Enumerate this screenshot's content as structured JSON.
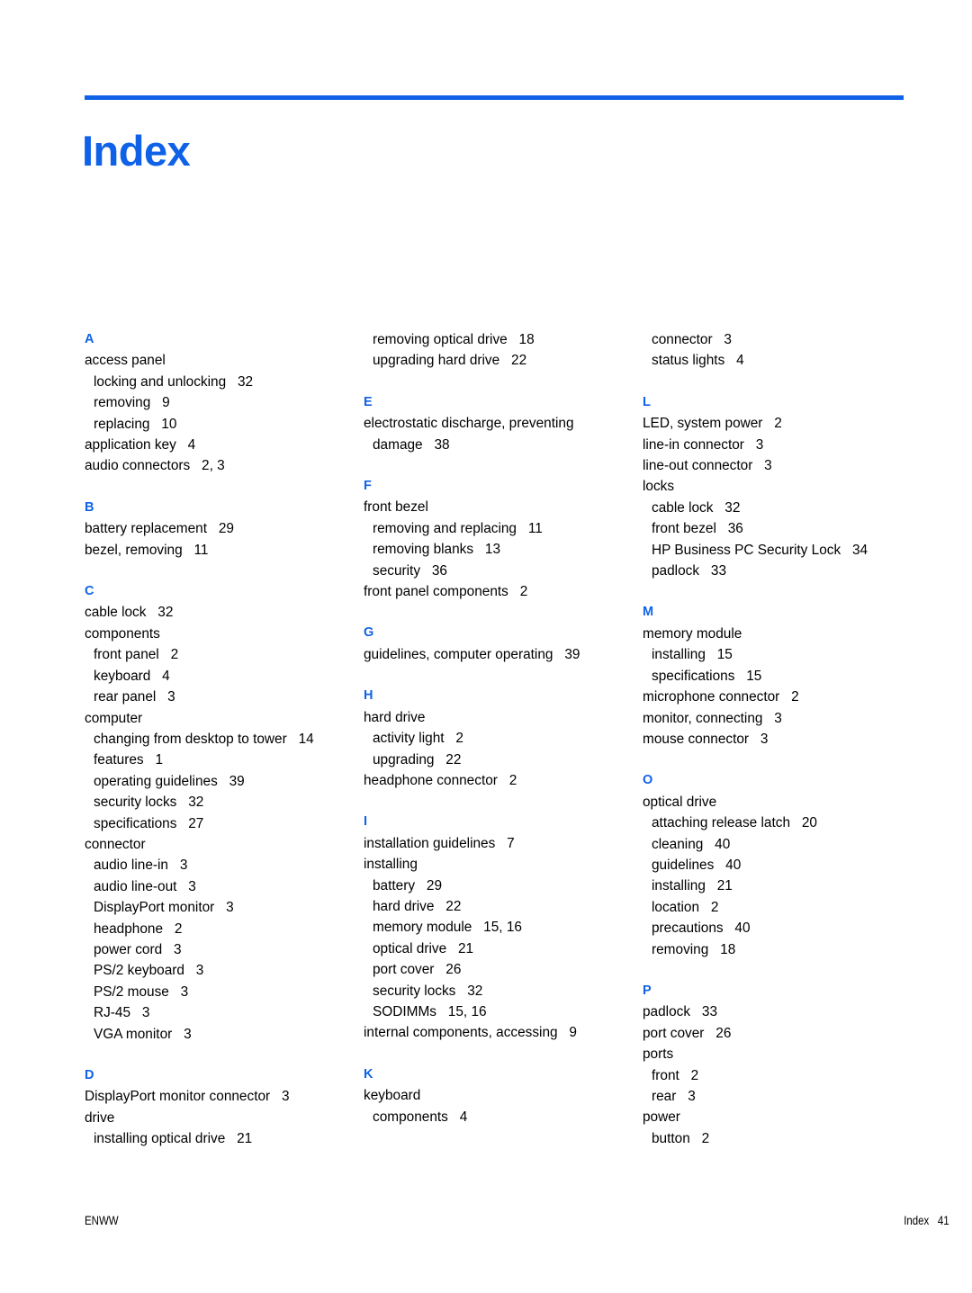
{
  "document": {
    "title": "Index",
    "accent_color": "#0f62e8",
    "text_color": "#000000",
    "background_color": "#ffffff"
  },
  "footer": {
    "left": "ENWW",
    "right": "Index   41"
  },
  "columns": [
    {
      "id": "column-1",
      "blocks": [
        {
          "type": "letter",
          "text": "A",
          "first": true
        },
        {
          "type": "entry",
          "level": 1,
          "text": "access panel",
          "page": ""
        },
        {
          "type": "entry",
          "level": 2,
          "text": "locking and unlocking",
          "page": "32"
        },
        {
          "type": "entry",
          "level": 2,
          "text": "removing",
          "page": "9"
        },
        {
          "type": "entry",
          "level": 2,
          "text": "replacing",
          "page": "10"
        },
        {
          "type": "entry",
          "level": 1,
          "text": "application key",
          "page": "4"
        },
        {
          "type": "entry",
          "level": 1,
          "text": "audio connectors",
          "page": "2, 3"
        },
        {
          "type": "letter",
          "text": "B",
          "first": false
        },
        {
          "type": "entry",
          "level": 1,
          "text": "battery replacement",
          "page": "29"
        },
        {
          "type": "entry",
          "level": 1,
          "text": "bezel, removing",
          "page": "11"
        },
        {
          "type": "letter",
          "text": "C",
          "first": false
        },
        {
          "type": "entry",
          "level": 1,
          "text": "cable lock",
          "page": "32"
        },
        {
          "type": "entry",
          "level": 1,
          "text": "components",
          "page": ""
        },
        {
          "type": "entry",
          "level": 2,
          "text": "front panel",
          "page": "2"
        },
        {
          "type": "entry",
          "level": 2,
          "text": "keyboard",
          "page": "4"
        },
        {
          "type": "entry",
          "level": 2,
          "text": "rear panel",
          "page": "3"
        },
        {
          "type": "entry",
          "level": 1,
          "text": "computer",
          "page": ""
        },
        {
          "type": "entry",
          "level": 2,
          "text": "changing from desktop to tower",
          "page": "14"
        },
        {
          "type": "entry",
          "level": 2,
          "text": "features",
          "page": "1"
        },
        {
          "type": "entry",
          "level": 2,
          "text": "operating guidelines",
          "page": "39"
        },
        {
          "type": "entry",
          "level": 2,
          "text": "security locks",
          "page": "32"
        },
        {
          "type": "entry",
          "level": 2,
          "text": "specifications",
          "page": "27"
        },
        {
          "type": "entry",
          "level": 1,
          "text": "connector",
          "page": ""
        },
        {
          "type": "entry",
          "level": 2,
          "text": "audio line-in",
          "page": "3"
        },
        {
          "type": "entry",
          "level": 2,
          "text": "audio line-out",
          "page": "3"
        },
        {
          "type": "entry",
          "level": 2,
          "text": "DisplayPort monitor",
          "page": "3"
        },
        {
          "type": "entry",
          "level": 2,
          "text": "headphone",
          "page": "2"
        },
        {
          "type": "entry",
          "level": 2,
          "text": "power cord",
          "page": "3"
        },
        {
          "type": "entry",
          "level": 2,
          "text": "PS/2 keyboard",
          "page": "3"
        },
        {
          "type": "entry",
          "level": 2,
          "text": "PS/2 mouse",
          "page": "3"
        },
        {
          "type": "entry",
          "level": 2,
          "text": "RJ-45",
          "page": "3"
        },
        {
          "type": "entry",
          "level": 2,
          "text": "VGA monitor",
          "page": "3"
        },
        {
          "type": "letter",
          "text": "D",
          "first": false
        },
        {
          "type": "entry",
          "level": 1,
          "text": "DisplayPort monitor connector",
          "page": "3"
        },
        {
          "type": "entry",
          "level": 1,
          "text": "drive",
          "page": ""
        },
        {
          "type": "entry",
          "level": 2,
          "text": "installing optical drive",
          "page": "21"
        }
      ]
    },
    {
      "id": "column-2",
      "blocks": [
        {
          "type": "entry",
          "level": 2,
          "text": "removing optical drive",
          "page": "18"
        },
        {
          "type": "entry",
          "level": 2,
          "text": "upgrading hard drive",
          "page": "22"
        },
        {
          "type": "letter",
          "text": "E",
          "first": false
        },
        {
          "type": "entry",
          "level": 1,
          "text": "electrostatic discharge, preventing damage",
          "page": "38"
        },
        {
          "type": "letter",
          "text": "F",
          "first": false
        },
        {
          "type": "entry",
          "level": 1,
          "text": "front bezel",
          "page": ""
        },
        {
          "type": "entry",
          "level": 2,
          "text": "removing and replacing",
          "page": "11"
        },
        {
          "type": "entry",
          "level": 2,
          "text": "removing blanks",
          "page": "13"
        },
        {
          "type": "entry",
          "level": 2,
          "text": "security",
          "page": "36"
        },
        {
          "type": "entry",
          "level": 1,
          "text": "front panel components",
          "page": "2"
        },
        {
          "type": "letter",
          "text": "G",
          "first": false
        },
        {
          "type": "entry",
          "level": 1,
          "text": "guidelines, computer operating",
          "page": "39"
        },
        {
          "type": "letter",
          "text": "H",
          "first": false
        },
        {
          "type": "entry",
          "level": 1,
          "text": "hard drive",
          "page": ""
        },
        {
          "type": "entry",
          "level": 2,
          "text": "activity light",
          "page": "2"
        },
        {
          "type": "entry",
          "level": 2,
          "text": "upgrading",
          "page": "22"
        },
        {
          "type": "entry",
          "level": 1,
          "text": "headphone connector",
          "page": "2"
        },
        {
          "type": "letter",
          "text": "I",
          "first": false
        },
        {
          "type": "entry",
          "level": 1,
          "text": "installation guidelines",
          "page": "7"
        },
        {
          "type": "entry",
          "level": 1,
          "text": "installing",
          "page": ""
        },
        {
          "type": "entry",
          "level": 2,
          "text": "battery",
          "page": "29"
        },
        {
          "type": "entry",
          "level": 2,
          "text": "hard drive",
          "page": "22"
        },
        {
          "type": "entry",
          "level": 2,
          "text": "memory module",
          "page": "15, 16"
        },
        {
          "type": "entry",
          "level": 2,
          "text": "optical drive",
          "page": "21"
        },
        {
          "type": "entry",
          "level": 2,
          "text": "port cover",
          "page": "26"
        },
        {
          "type": "entry",
          "level": 2,
          "text": "security locks",
          "page": "32"
        },
        {
          "type": "entry",
          "level": 2,
          "text": "SODIMMs",
          "page": "15, 16"
        },
        {
          "type": "entry",
          "level": 1,
          "text": "internal components, accessing",
          "page": "9"
        },
        {
          "type": "letter",
          "text": "K",
          "first": false
        },
        {
          "type": "entry",
          "level": 1,
          "text": "keyboard",
          "page": ""
        },
        {
          "type": "entry",
          "level": 2,
          "text": "components",
          "page": "4"
        }
      ]
    },
    {
      "id": "column-3",
      "blocks": [
        {
          "type": "entry",
          "level": 2,
          "text": "connector",
          "page": "3"
        },
        {
          "type": "entry",
          "level": 2,
          "text": "status lights",
          "page": "4"
        },
        {
          "type": "letter",
          "text": "L",
          "first": false
        },
        {
          "type": "entry",
          "level": 1,
          "text": "LED, system power",
          "page": "2"
        },
        {
          "type": "entry",
          "level": 1,
          "text": "line-in connector",
          "page": "3"
        },
        {
          "type": "entry",
          "level": 1,
          "text": "line-out connector",
          "page": "3"
        },
        {
          "type": "entry",
          "level": 1,
          "text": "locks",
          "page": ""
        },
        {
          "type": "entry",
          "level": 2,
          "text": "cable lock",
          "page": "32"
        },
        {
          "type": "entry",
          "level": 2,
          "text": "front bezel",
          "page": "36"
        },
        {
          "type": "entry",
          "level": 2,
          "text": "HP Business PC Security Lock",
          "page": "34"
        },
        {
          "type": "entry",
          "level": 2,
          "text": "padlock",
          "page": "33"
        },
        {
          "type": "letter",
          "text": "M",
          "first": false
        },
        {
          "type": "entry",
          "level": 1,
          "text": "memory module",
          "page": ""
        },
        {
          "type": "entry",
          "level": 2,
          "text": "installing",
          "page": "15"
        },
        {
          "type": "entry",
          "level": 2,
          "text": "specifications",
          "page": "15"
        },
        {
          "type": "entry",
          "level": 1,
          "text": "microphone connector",
          "page": "2"
        },
        {
          "type": "entry",
          "level": 1,
          "text": "monitor, connecting",
          "page": "3"
        },
        {
          "type": "entry",
          "level": 1,
          "text": "mouse connector",
          "page": "3"
        },
        {
          "type": "letter",
          "text": "O",
          "first": false
        },
        {
          "type": "entry",
          "level": 1,
          "text": "optical drive",
          "page": ""
        },
        {
          "type": "entry",
          "level": 2,
          "text": "attaching release latch",
          "page": "20"
        },
        {
          "type": "entry",
          "level": 2,
          "text": "cleaning",
          "page": "40"
        },
        {
          "type": "entry",
          "level": 2,
          "text": "guidelines",
          "page": "40"
        },
        {
          "type": "entry",
          "level": 2,
          "text": "installing",
          "page": "21"
        },
        {
          "type": "entry",
          "level": 2,
          "text": "location",
          "page": "2"
        },
        {
          "type": "entry",
          "level": 2,
          "text": "precautions",
          "page": "40"
        },
        {
          "type": "entry",
          "level": 2,
          "text": "removing",
          "page": "18"
        },
        {
          "type": "letter",
          "text": "P",
          "first": false
        },
        {
          "type": "entry",
          "level": 1,
          "text": "padlock",
          "page": "33"
        },
        {
          "type": "entry",
          "level": 1,
          "text": "port cover",
          "page": "26"
        },
        {
          "type": "entry",
          "level": 1,
          "text": "ports",
          "page": ""
        },
        {
          "type": "entry",
          "level": 2,
          "text": "front",
          "page": "2"
        },
        {
          "type": "entry",
          "level": 2,
          "text": "rear",
          "page": "3"
        },
        {
          "type": "entry",
          "level": 1,
          "text": "power",
          "page": ""
        },
        {
          "type": "entry",
          "level": 2,
          "text": "button",
          "page": "2"
        }
      ]
    }
  ]
}
